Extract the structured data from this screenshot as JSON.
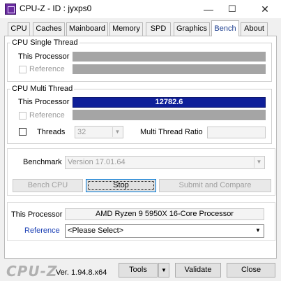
{
  "window": {
    "title": "CPU-Z - ID : jyxps0"
  },
  "window_controls": {
    "minimize": "—",
    "maximize": "☐",
    "close": "✕"
  },
  "tabs": [
    {
      "label": "CPU"
    },
    {
      "label": "Caches"
    },
    {
      "label": "Mainboard"
    },
    {
      "label": "Memory"
    },
    {
      "label": "SPD"
    },
    {
      "label": "Graphics"
    },
    {
      "label": "Bench"
    },
    {
      "label": "About"
    }
  ],
  "active_tab": "Bench",
  "single_thread": {
    "title": "CPU Single Thread",
    "this_processor_label": "This Processor",
    "reference_label": "Reference"
  },
  "multi_thread": {
    "title": "CPU Multi Thread",
    "this_processor_label": "This Processor",
    "this_processor_score": "12782.6",
    "this_processor_fill": 1.0,
    "reference_label": "Reference",
    "threads_label": "Threads",
    "threads_value": "32",
    "ratio_label": "Multi Thread Ratio"
  },
  "benchmark": {
    "label": "Benchmark",
    "version": "Version 17.01.64",
    "bench_cpu": "Bench CPU",
    "stop": "Stop",
    "submit": "Submit and Compare"
  },
  "processor_info": {
    "this_processor_label": "This Processor",
    "this_processor_value": "AMD Ryzen 9 5950X 16-Core Processor",
    "reference_label": "Reference",
    "reference_value": "<Please Select>"
  },
  "footer": {
    "logo": "CPU-Z",
    "version": "Ver. 1.94.8.x64",
    "tools": "Tools",
    "tools_arrow": "▼",
    "validate": "Validate",
    "close": "Close"
  },
  "colors": {
    "score_bar": "#0f1f99",
    "empty_bar": "#a5a5a5",
    "accent_link": "#1a3fb4"
  },
  "icons": {
    "app": "cpu-z-icon",
    "dropdown": "chevron-down-icon"
  }
}
